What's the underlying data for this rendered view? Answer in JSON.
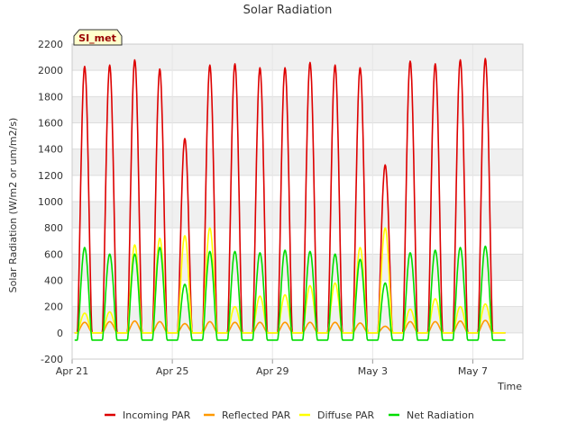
{
  "chart_data": {
    "type": "line",
    "title": "Solar Radiation",
    "xlabel": "Time",
    "ylabel": "Solar Radiation (W/m2 or um/m2/s)",
    "site_label": "SI_met",
    "ylim": [
      -200,
      2200
    ],
    "y_ticks": [
      -200,
      0,
      200,
      400,
      600,
      800,
      1000,
      1200,
      1400,
      1600,
      1800,
      2000,
      2200
    ],
    "x_ticks": [
      {
        "day": 0,
        "label": "Apr 21"
      },
      {
        "day": 4,
        "label": "Apr 25"
      },
      {
        "day": 8,
        "label": "Apr 29"
      },
      {
        "day": 12,
        "label": "May 3"
      },
      {
        "day": 16,
        "label": "May 7"
      }
    ],
    "xlim_days": [
      0,
      18
    ],
    "grid": true,
    "legend_position": "bottom",
    "days": [
      0.5,
      1.5,
      2.5,
      3.5,
      4.5,
      5.5,
      6.5,
      7.5,
      8.5,
      9.5,
      10.5,
      11.5,
      12.5,
      13.5,
      14.5,
      15.5,
      16.5
    ],
    "series": [
      {
        "name": "Incoming PAR",
        "color": "#dd0000",
        "peaks": [
          2030,
          2040,
          2080,
          2010,
          1480,
          2040,
          2050,
          2020,
          2020,
          2060,
          2040,
          2020,
          1280,
          2070,
          2050,
          2080,
          2090
        ]
      },
      {
        "name": "Reflected PAR",
        "color": "#ff9900",
        "peaks": [
          80,
          85,
          90,
          85,
          70,
          85,
          80,
          80,
          80,
          80,
          80,
          75,
          50,
          85,
          85,
          90,
          95
        ]
      },
      {
        "name": "Diffuse PAR",
        "color": "#ffff00",
        "peaks": [
          150,
          160,
          670,
          720,
          740,
          800,
          200,
          280,
          290,
          360,
          380,
          650,
          800,
          180,
          260,
          200,
          220
        ]
      },
      {
        "name": "Net Radiation",
        "color": "#00dd00",
        "peaks": [
          650,
          600,
          600,
          650,
          370,
          620,
          620,
          610,
          630,
          620,
          600,
          560,
          380,
          610,
          630,
          650,
          660
        ]
      }
    ],
    "net_night_value": -55
  }
}
